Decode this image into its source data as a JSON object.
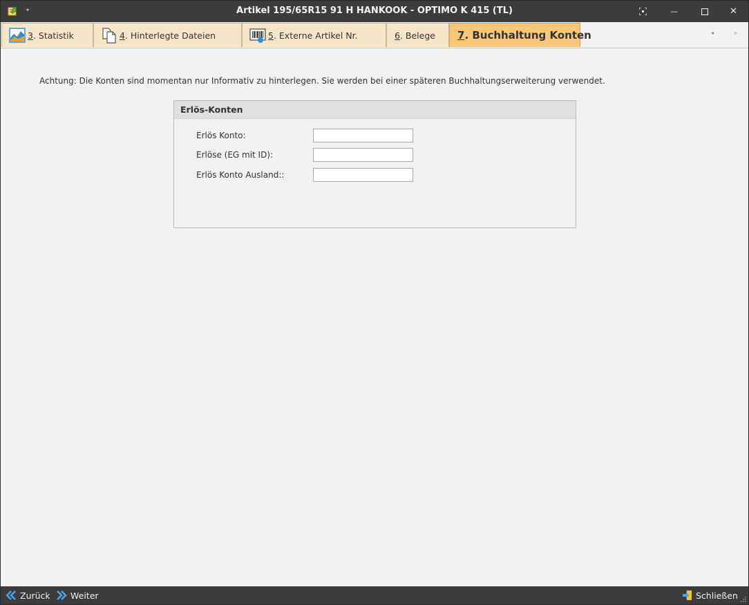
{
  "window": {
    "title": "Artikel 195/65R15 91 H HANKOOK - OPTIMO K 415 (TL)",
    "icons": [
      "app-notepad-icon",
      "quick-access-arrow-icon",
      "fullscreen-icon",
      "minimize-icon",
      "maximize-icon",
      "close-icon"
    ],
    "qa_arrow": "▾",
    "minimize_glyph": "—",
    "close_glyph": "✕"
  },
  "tabs": [
    {
      "num": "3",
      "rest": ". Statistik",
      "icon": "statistics-icon",
      "active": false
    },
    {
      "num": "4",
      "rest": ". Hinterlegte Dateien",
      "icon": "documents-icon",
      "active": false
    },
    {
      "num": "5",
      "rest": ". Externe Artikel Nr.",
      "icon": "barcode-icon",
      "active": false
    },
    {
      "num": "6",
      "rest": ". Belege",
      "icon": "",
      "active": false
    },
    {
      "num": "7",
      "rest": ". Buchhaltung Konten",
      "icon": "",
      "active": true
    }
  ],
  "tab_scroll": {
    "left": "◂",
    "right": "▸"
  },
  "content": {
    "notice": "Achtung: Die Konten sind momentan nur Informativ zu hinterlegen. Sie werden bei einer späteren Buchhaltungserweiterung verwendet.",
    "group": {
      "title": "Erlös-Konten",
      "fields": [
        {
          "label": "Erlös Konto:",
          "value": ""
        },
        {
          "label": "Erlöse (EG mit ID):",
          "value": ""
        },
        {
          "label": "Erlös Konto Ausland::",
          "value": ""
        }
      ]
    }
  },
  "bottombar": {
    "back_label": "Zurück",
    "forward_label": "Weiter",
    "close_label": "Schließen"
  },
  "colors": {
    "titlebar": "#3c3c3c",
    "tab_inactive": "#f6e6c8",
    "tab_active": "#f8c77a",
    "accent_blue": "#2a8fd6"
  }
}
